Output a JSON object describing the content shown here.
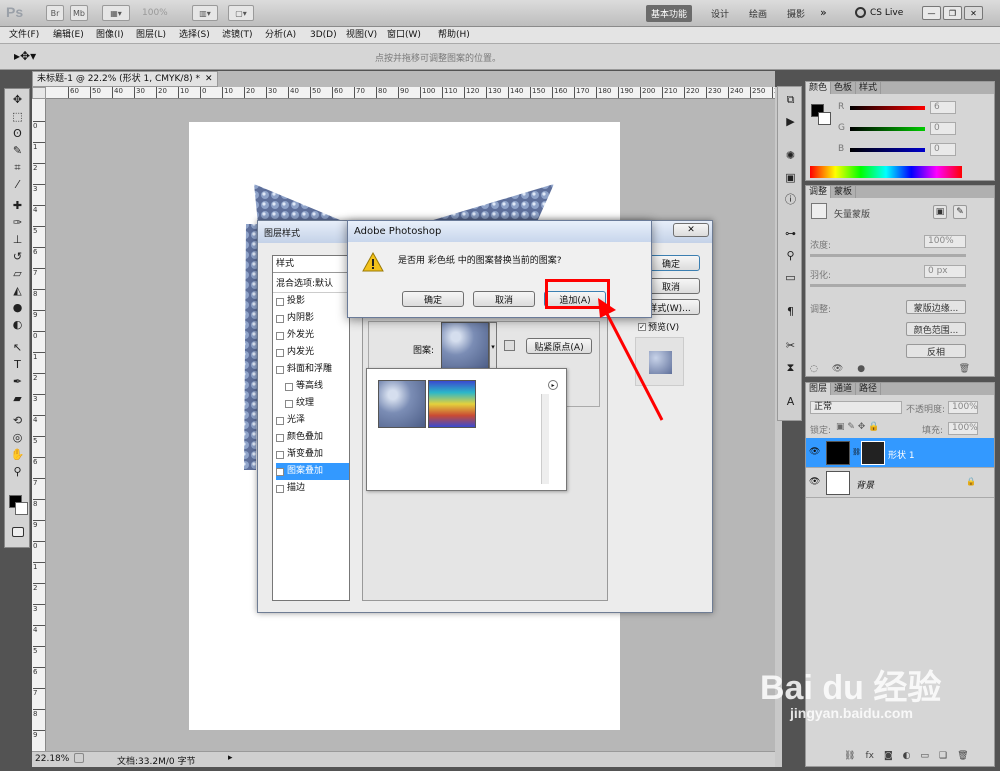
{
  "app": {
    "logo": "Ps",
    "zoom": "100%",
    "workspaces": [
      "基本功能",
      "设计",
      "绘画",
      "摄影"
    ],
    "more": "»",
    "cslive": "CS Live"
  },
  "menu": [
    "文件(F)",
    "编辑(E)",
    "图像(I)",
    "图层(L)",
    "选择(S)",
    "滤镜(T)",
    "分析(A)",
    "3D(D)",
    "视图(V)",
    "窗口(W)",
    "帮助(H)"
  ],
  "options": {
    "hint": "点按并拖移可调整图案的位置。"
  },
  "document": {
    "tab": "未标题-1 @ 22.2% (形状 1, CMYK/8) *",
    "ruler_top": [
      "60",
      "50",
      "40",
      "30",
      "20",
      "10",
      "0",
      "10",
      "20",
      "30",
      "40",
      "50",
      "60",
      "70",
      "80",
      "90",
      "100",
      "110",
      "120",
      "130",
      "140",
      "150",
      "160",
      "170",
      "180",
      "190",
      "200",
      "210",
      "220",
      "230",
      "240",
      "250",
      "260"
    ],
    "ruler_left": [
      "0",
      "1",
      "2",
      "3",
      "4",
      "5",
      "6",
      "7",
      "8",
      "9",
      "0",
      "1",
      "2",
      "3",
      "4",
      "5",
      "6",
      "7",
      "8",
      "9",
      "0",
      "1",
      "2",
      "3",
      "4",
      "5",
      "6",
      "7",
      "8",
      "9"
    ],
    "zoom": "22.18%",
    "docinfo": "文档:33.2M/0 字节"
  },
  "color_panel": {
    "tabs": [
      "颜色",
      "色板",
      "样式"
    ],
    "r_label": "R",
    "g_label": "G",
    "b_label": "B",
    "r": "6",
    "g": "0",
    "b": "0"
  },
  "adjust_panel": {
    "tabs": [
      "调整",
      "蒙板"
    ],
    "mask_label": "矢量蒙版",
    "density_label": "浓度:",
    "density": "100%",
    "feather_label": "羽化:",
    "feather": "0 px",
    "refine_label": "调整:",
    "buttons": [
      "蒙版边缘...",
      "颜色范围...",
      "反相"
    ]
  },
  "layers_panel": {
    "tabs": [
      "图层",
      "通道",
      "路径"
    ],
    "blend": "正常",
    "opacity_label": "不透明度:",
    "opacity": "100%",
    "lock_label": "锁定:",
    "fill_label": "填充:",
    "fill": "100%",
    "layers": [
      {
        "name": "形状 1",
        "selected": true
      },
      {
        "name": "背景",
        "selected": false
      }
    ]
  },
  "layer_style": {
    "title": "图层样式",
    "styles_header": "样式",
    "blend_options": "混合选项:默认",
    "items": [
      {
        "label": "投影",
        "checked": false,
        "sub": false
      },
      {
        "label": "内阴影",
        "checked": false,
        "sub": false
      },
      {
        "label": "外发光",
        "checked": false,
        "sub": false
      },
      {
        "label": "内发光",
        "checked": false,
        "sub": false
      },
      {
        "label": "斜面和浮雕",
        "checked": false,
        "sub": false
      },
      {
        "label": "等高线",
        "checked": false,
        "sub": true
      },
      {
        "label": "纹理",
        "checked": false,
        "sub": true
      },
      {
        "label": "光泽",
        "checked": false,
        "sub": false
      },
      {
        "label": "颜色叠加",
        "checked": false,
        "sub": false
      },
      {
        "label": "渐变叠加",
        "checked": false,
        "sub": false
      },
      {
        "label": "图案叠加",
        "checked": true,
        "sub": false
      },
      {
        "label": "描边",
        "checked": false,
        "sub": false
      }
    ],
    "ok": "确定",
    "cancel": "取消",
    "new_style": "新建样式(W)...",
    "preview": "预览(V)",
    "pattern_label": "图案:",
    "snap": "贴紧原点(A)"
  },
  "alert": {
    "title": "Adobe Photoshop",
    "message": "是否用 彩色纸 中的图案替换当前的图案?",
    "ok": "确定",
    "cancel": "取消",
    "append": "追加(A)"
  },
  "watermark": {
    "main": "Bai du 经验",
    "sub": "jingyan.baidu.com"
  },
  "colors": {
    "highlight": "#3399ff",
    "annotation": "#ff0000"
  }
}
